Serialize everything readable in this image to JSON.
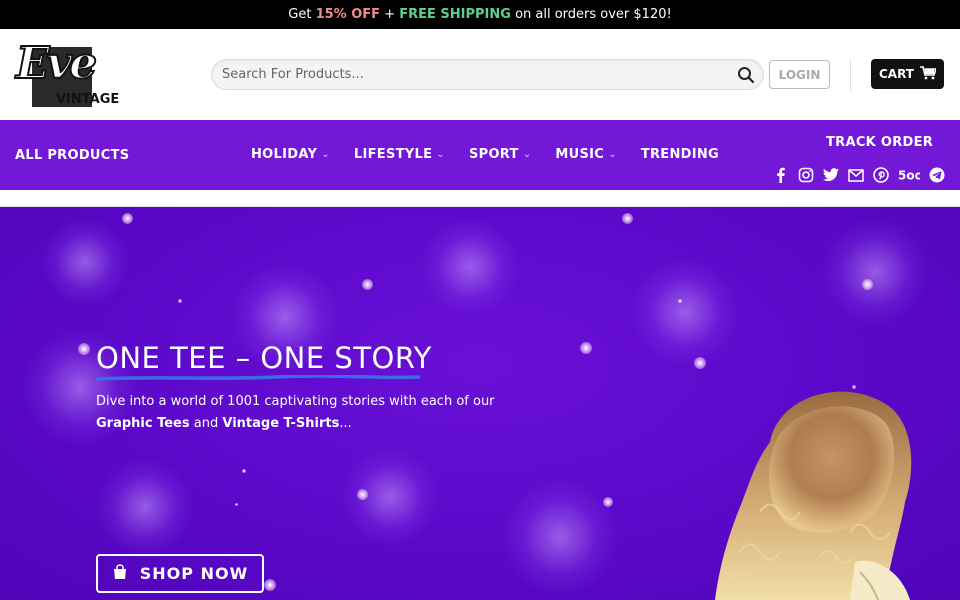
{
  "promo": {
    "prefix": "Get ",
    "discount": "15% OFF",
    "joiner": " + ",
    "shipping": "FREE SHIPPING",
    "suffix": " on all orders over $120!"
  },
  "header": {
    "logo_script": "Eve",
    "logo_sub": "VINTAGE",
    "search_placeholder": "Search For Products...",
    "login_label": "LOGIN",
    "cart_label": "CART"
  },
  "nav": {
    "all_products": "ALL PRODUCTS",
    "items": [
      {
        "label": "HOLIDAY",
        "dropdown": true
      },
      {
        "label": "LIFESTYLE",
        "dropdown": true
      },
      {
        "label": "SPORT",
        "dropdown": true
      },
      {
        "label": "MUSIC",
        "dropdown": true
      },
      {
        "label": "TRENDING",
        "dropdown": false
      }
    ],
    "track_order": "TRACK ORDER",
    "socials": [
      "facebook-icon",
      "instagram-icon",
      "twitter-icon",
      "email-icon",
      "pinterest-icon",
      "500px-icon",
      "telegram-icon"
    ]
  },
  "hero": {
    "title": "ONE TEE – ONE STORY",
    "desc_line1": "Dive into a world of 1001 captivating stories with each of our",
    "desc_bold1": "Graphic Tees",
    "desc_and": " and ",
    "desc_bold2": "Vintage T-Shirts",
    "desc_tail": "...",
    "cta": "SHOP NOW"
  },
  "colors": {
    "nav_purple": "#7218d6",
    "hero_purple": "#5b08c9",
    "promo_discount": "#f08a8a",
    "promo_shipping": "#5fd08c",
    "underline_blue": "#3d6be8"
  }
}
